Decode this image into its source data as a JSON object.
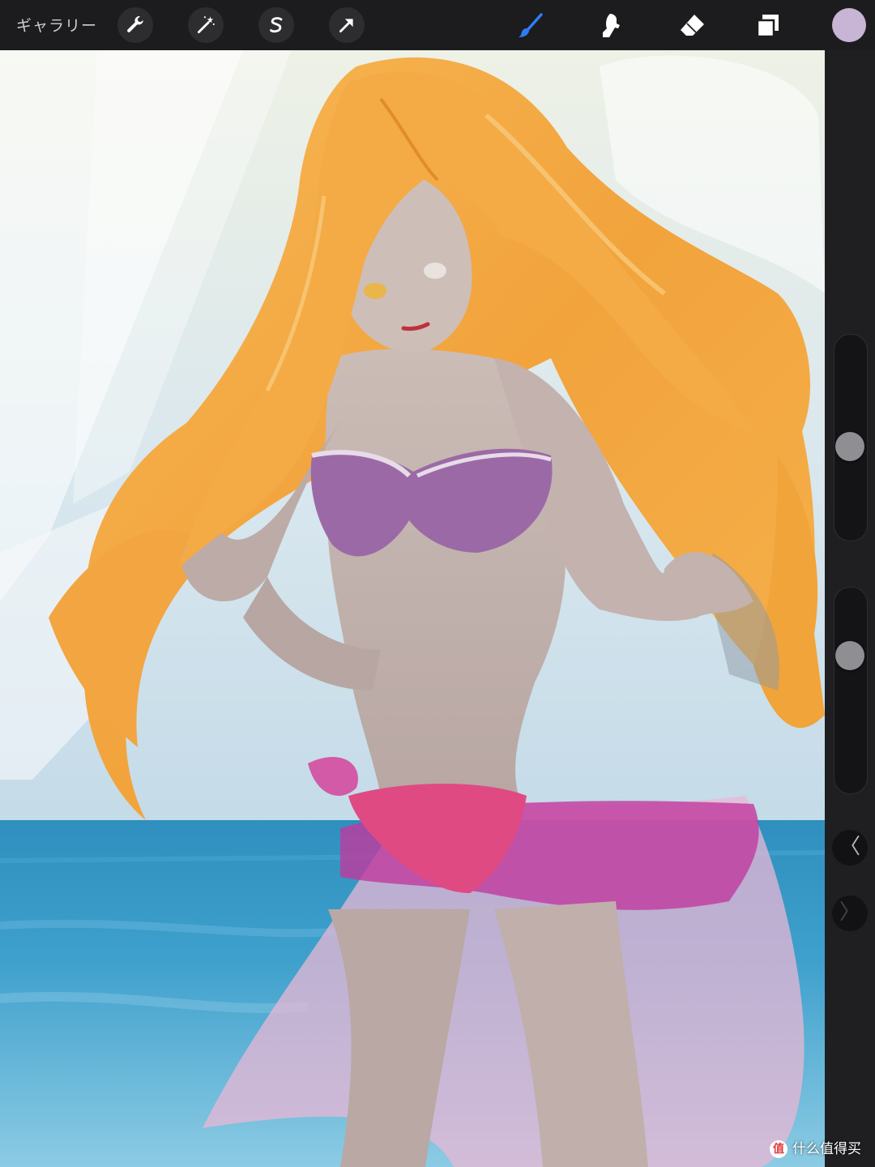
{
  "toolbar": {
    "gallery_label": "ギャラリー",
    "left_tools": [
      {
        "name": "wrench-icon",
        "role": "actions"
      },
      {
        "name": "magic-wand-icon",
        "role": "adjustments"
      },
      {
        "name": "selection-s-icon",
        "role": "selection"
      },
      {
        "name": "arrow-cursor-icon",
        "role": "transform"
      }
    ],
    "right_tools": [
      {
        "name": "brush-icon",
        "active": true
      },
      {
        "name": "smudge-icon",
        "active": false
      },
      {
        "name": "eraser-icon",
        "active": false
      },
      {
        "name": "layers-icon",
        "active": false
      }
    ],
    "current_color": "#c8b4d4",
    "active_accent": "#2f7cf6"
  },
  "sidebar": {
    "brush_size_level": 0.55,
    "opacity_level": 0.3,
    "undo_label": "〈",
    "redo_label": "〉"
  },
  "watermark": {
    "logo": "值",
    "text": "什么值得买"
  }
}
